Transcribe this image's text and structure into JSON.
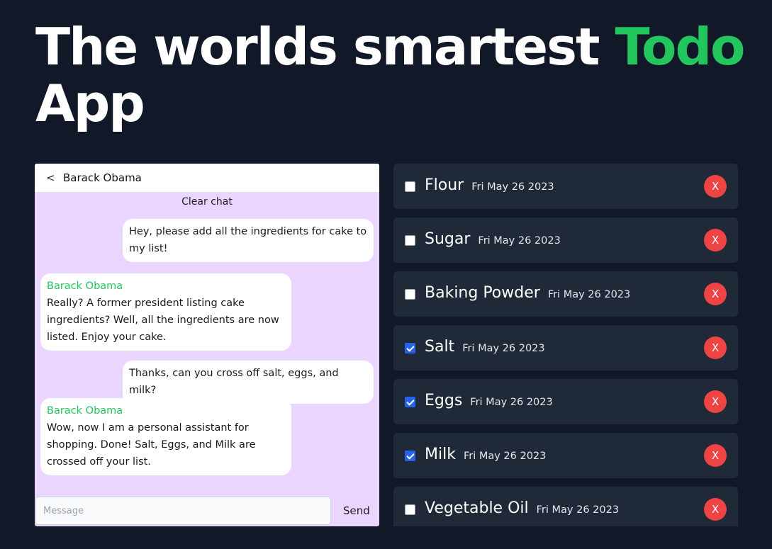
{
  "title": {
    "prefix": "The worlds smartest ",
    "accent": "Todo",
    "suffix": "App"
  },
  "colors": {
    "background": "#111827",
    "accent": "#22c55e",
    "chat_bg": "#e9d5ff",
    "todo_bg": "#1f2937",
    "delete": "#ef4444",
    "checked": "#2563eb"
  },
  "chat": {
    "back_icon": "<",
    "contact_name": "Barack Obama",
    "clear_label": "Clear chat",
    "messages": [
      {
        "from": "user",
        "text": "Hey, please add all the ingredients for cake to my list!"
      },
      {
        "from": "bot",
        "sender": "Barack Obama",
        "text": "Really? A former president listing cake ingredients? Well, all the ingredients are now listed. Enjoy your cake."
      },
      {
        "from": "user",
        "text": "Thanks, can you cross off salt, eggs, and milk?"
      },
      {
        "from": "bot",
        "sender": "Barack Obama",
        "text": "Wow, now I am a personal assistant for shopping. Done! Salt, Eggs, and Milk are crossed off your list."
      }
    ],
    "input_placeholder": "Message",
    "send_label": "Send"
  },
  "todos": {
    "delete_label": "X",
    "items": [
      {
        "name": "Flour",
        "date": "Fri May 26 2023",
        "checked": false
      },
      {
        "name": "Sugar",
        "date": "Fri May 26 2023",
        "checked": false
      },
      {
        "name": "Baking Powder",
        "date": "Fri May 26 2023",
        "checked": false
      },
      {
        "name": "Salt",
        "date": "Fri May 26 2023",
        "checked": true
      },
      {
        "name": "Eggs",
        "date": "Fri May 26 2023",
        "checked": true
      },
      {
        "name": "Milk",
        "date": "Fri May 26 2023",
        "checked": true
      },
      {
        "name": "Vegetable Oil",
        "date": "Fri May 26 2023",
        "checked": false
      }
    ]
  }
}
